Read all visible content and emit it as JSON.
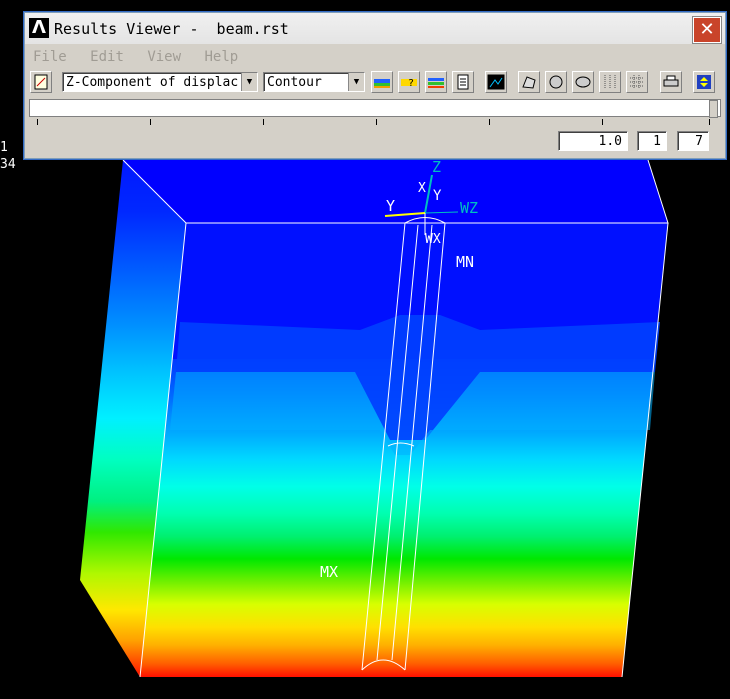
{
  "window": {
    "title": "Results Viewer -  beam.rst",
    "close_glyph": "✕",
    "logo_glyph": "Λ"
  },
  "menu": [
    "File",
    "Edit",
    "View",
    "Help"
  ],
  "toolbar": {
    "result_item": "Z-Component of displac",
    "plot_style": "Contour"
  },
  "controls": {
    "scale_value": "1.0",
    "step_value": "1",
    "step_count": "7"
  },
  "side_labels": [
    "1",
    "34"
  ],
  "plot": {
    "labels": {
      "axis_z": "Z",
      "axis_x": "X",
      "axis_y": "Y",
      "axis_y_left": "Y",
      "wp_z": "WZ",
      "wp_x": "WX",
      "min_label": "MN",
      "max_label": "MX"
    },
    "colors": {
      "min": "#0000ff",
      "max": "#ff0000",
      "axis_label": "#00c0c0",
      "edge": "#ffffff"
    }
  }
}
